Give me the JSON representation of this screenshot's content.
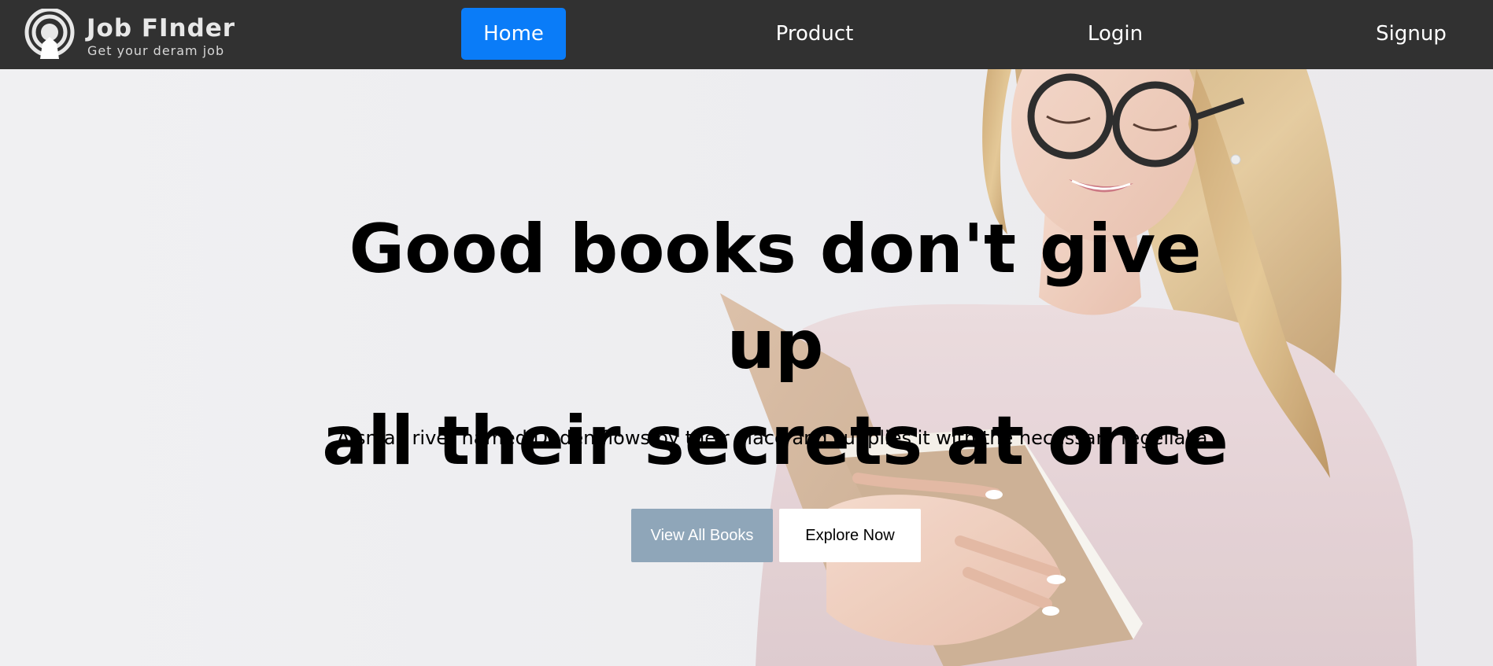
{
  "navbar": {
    "logo": {
      "icon": "signal-person-icon",
      "title": "Job FInder",
      "tagline": "Get your deram job"
    },
    "links": {
      "home": "Home",
      "product": "Product",
      "login": "Login",
      "signup": "Signup"
    },
    "active_link": "Home",
    "colors": {
      "background": "#313131",
      "active": "#0a7cf8"
    }
  },
  "hero": {
    "headline_line1": "Good books don't give up",
    "headline_line2": "all their secrets at once",
    "subtitle": "A small river named Duden flows by their place and supplies it with the necessary regelialia.",
    "image": "woman-reading-book",
    "buttons": {
      "view_all": "View All Books",
      "explore": "Explore Now"
    },
    "colors": {
      "view_all_bg": "#8fa6b9",
      "explore_bg": "#ffffff"
    }
  }
}
